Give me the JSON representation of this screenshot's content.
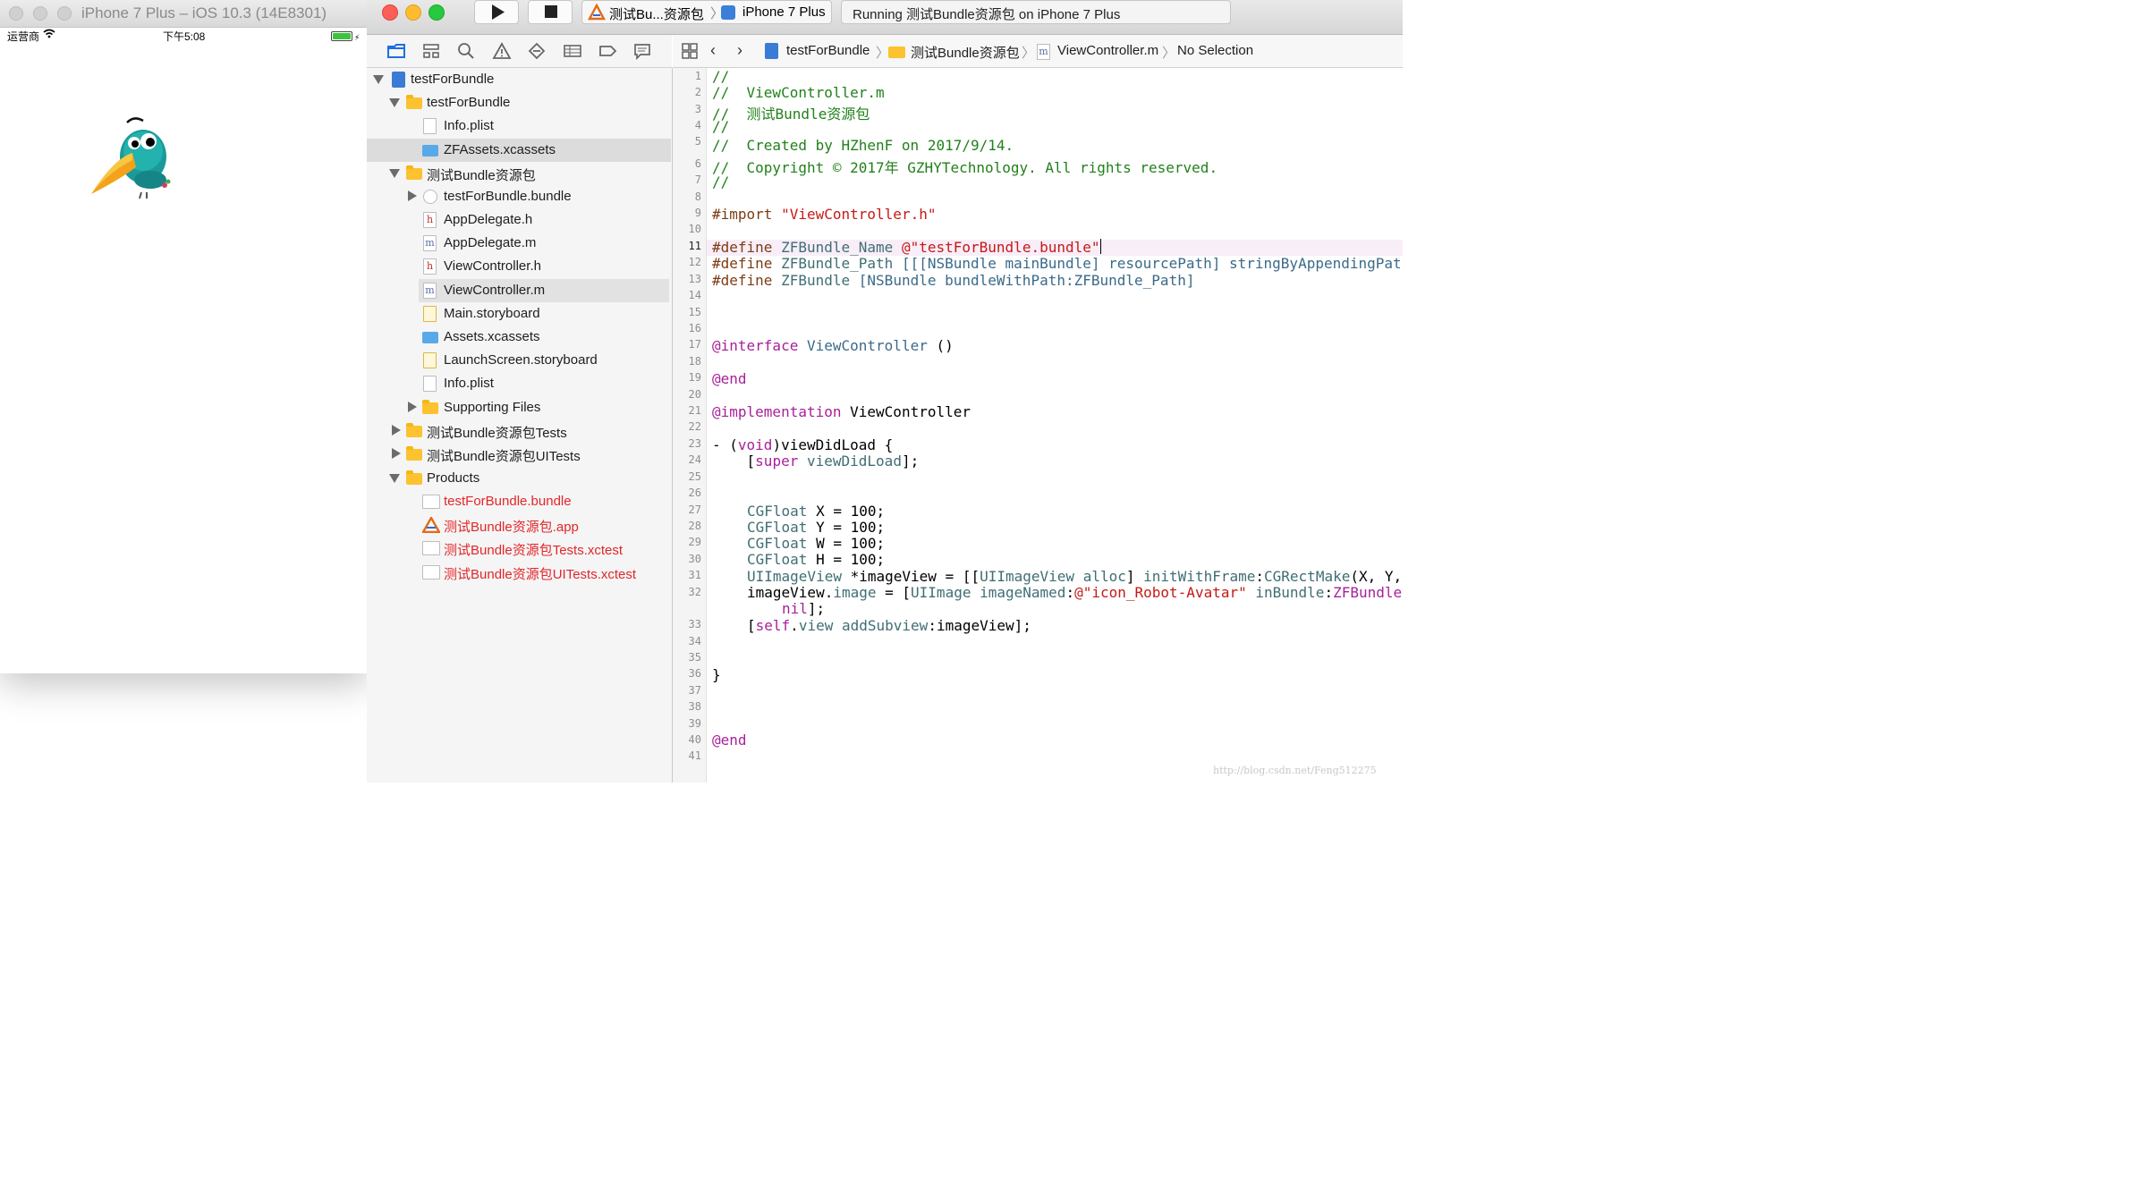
{
  "simulator": {
    "title": "iPhone 7 Plus – iOS 10.3 (14E8301)",
    "status": {
      "carrier": "运营商",
      "time": "下午5:08"
    }
  },
  "toolbar": {
    "scheme_target": "测试Bu...资源包",
    "scheme_device": "iPhone 7 Plus",
    "activity": "Running 测试Bundle资源包 on iPhone 7 Plus"
  },
  "jumpbar": {
    "crumbs": [
      "testForBundle",
      "测试Bundle资源包",
      "ViewController.m",
      "No Selection"
    ]
  },
  "navigator": {
    "items": [
      {
        "label": "testForBundle"
      },
      {
        "label": "testForBundle"
      },
      {
        "label": "Info.plist"
      },
      {
        "label": "ZFAssets.xcassets"
      },
      {
        "label": "测试Bundle资源包"
      },
      {
        "label": "testForBundle.bundle"
      },
      {
        "label": "AppDelegate.h"
      },
      {
        "label": "AppDelegate.m"
      },
      {
        "label": "ViewController.h"
      },
      {
        "label": "ViewController.m"
      },
      {
        "label": "Main.storyboard"
      },
      {
        "label": "Assets.xcassets"
      },
      {
        "label": "LaunchScreen.storyboard"
      },
      {
        "label": "Info.plist"
      },
      {
        "label": "Supporting Files"
      },
      {
        "label": "测试Bundle资源包Tests"
      },
      {
        "label": "测试Bundle资源包UITests"
      },
      {
        "label": "Products"
      },
      {
        "label": "testForBundle.bundle"
      },
      {
        "label": "测试Bundle资源包.app"
      },
      {
        "label": "测试Bundle资源包Tests.xctest"
      },
      {
        "label": "测试Bundle资源包UITests.xctest"
      }
    ]
  },
  "editor": {
    "lines": [
      {
        "num": "1"
      },
      {
        "num": "2"
      },
      {
        "num": "3"
      },
      {
        "num": "4"
      },
      {
        "num": "5"
      },
      {
        "num": "6"
      },
      {
        "num": "7"
      },
      {
        "num": "8"
      },
      {
        "num": "9"
      },
      {
        "num": "10"
      },
      {
        "num": "11"
      },
      {
        "num": "12"
      },
      {
        "num": "13"
      },
      {
        "num": "14"
      },
      {
        "num": "15"
      },
      {
        "num": "16"
      },
      {
        "num": "17"
      },
      {
        "num": "18"
      },
      {
        "num": "19"
      },
      {
        "num": "20"
      },
      {
        "num": "21"
      },
      {
        "num": "22"
      },
      {
        "num": "23"
      },
      {
        "num": "24"
      },
      {
        "num": "25"
      },
      {
        "num": "26"
      },
      {
        "num": "27"
      },
      {
        "num": "28"
      },
      {
        "num": "29"
      },
      {
        "num": "30"
      },
      {
        "num": "31"
      },
      {
        "num": "32"
      },
      {
        "num": "33"
      },
      {
        "num": "34"
      },
      {
        "num": "35"
      },
      {
        "num": "36"
      },
      {
        "num": "37"
      },
      {
        "num": "38"
      },
      {
        "num": "39"
      },
      {
        "num": "40"
      },
      {
        "num": "41"
      }
    ],
    "code": {
      "l1": "//",
      "l2": "//  ViewController.m",
      "l3": "//  测试Bundle资源包",
      "l4": "//",
      "l5": "//  Created by HZhenF on 2017/9/14.",
      "l6": "//  Copyright © 2017年 GZHYTechnology. All rights reserved.",
      "l7": "//",
      "l9_kw": "#import",
      "l9_str": "\"ViewController.h\"",
      "l11_kw": "#define",
      "l11_name": "ZFBundle_Name",
      "l11_str": "@\"testForBundle.bundle\"",
      "l12_kw": "#define",
      "l12_name": "ZFBundle_Path",
      "l12_rest": "[[[NSBundle mainBundle] resourcePath] stringByAppendingPathComponent:ZFBundle_Name]",
      "l13_kw": "#define",
      "l13_name": "ZFBundle",
      "l13_rest": "[NSBundle bundleWithPath:ZFBundle_Path]",
      "l17_kw": "@interface",
      "l17_name": "ViewController",
      "l17_rest": "()",
      "l19": "@end",
      "l21_kw": "@implementation",
      "l21_rest": "ViewController",
      "l23_a": "- (",
      "l23_kw": "void",
      "l23_b": ")viewDidLoad {",
      "l24_a": "    [",
      "l24_kw": "super",
      "l24_m": "viewDidLoad",
      "l24_b": "];",
      "l27": "CGFloat",
      "l27_var": " X = ",
      "l27_num": "100",
      "l28_var": " Y = ",
      "l28_num": "100",
      "l29_var": " W = ",
      "l29_num": "100",
      "l30_var": " H = ",
      "l30_num": "100",
      "l31_type": "UIImageView",
      "l31_a": " *imageView = [[",
      "l31_type2": "UIImageView",
      "l31_m": "alloc",
      "l31_b": "] ",
      "l31_m2": "initWithFrame",
      "l31_c": ":",
      "l31_m3": "CGRectMake",
      "l31_d": "(X, Y, W, H)];",
      "l32_a": "imageView.",
      "l32_prop": "image",
      "l32_b": " = [",
      "l32_type": "UIImage",
      "l32_m": "imageNamed",
      "l32_c": ":",
      "l32_str": "@\"icon_Robot-Avatar\"",
      "l32_m2": "inBundle",
      "l32_d": ":",
      "l32_macro": "ZFBundle compatibleWithTraitCollection:",
      "l32b_kw": "nil",
      "l32b_rest": "];",
      "l33_a": "[",
      "l33_kw": "self",
      "l33_b": ".",
      "l33_prop": "view",
      "l33_m": "addSubview",
      "l33_c": ":imageView];",
      "l36": "}",
      "l40": "@end"
    }
  },
  "watermark": "http://blog.csdn.net/Feng512275",
  "colors": {
    "comment": "#22811b",
    "keyword": "#a8209a",
    "string": "#c41a16",
    "type": "#3b6a8a",
    "number": "#1c00cf",
    "product_missing": "#e3262a"
  }
}
